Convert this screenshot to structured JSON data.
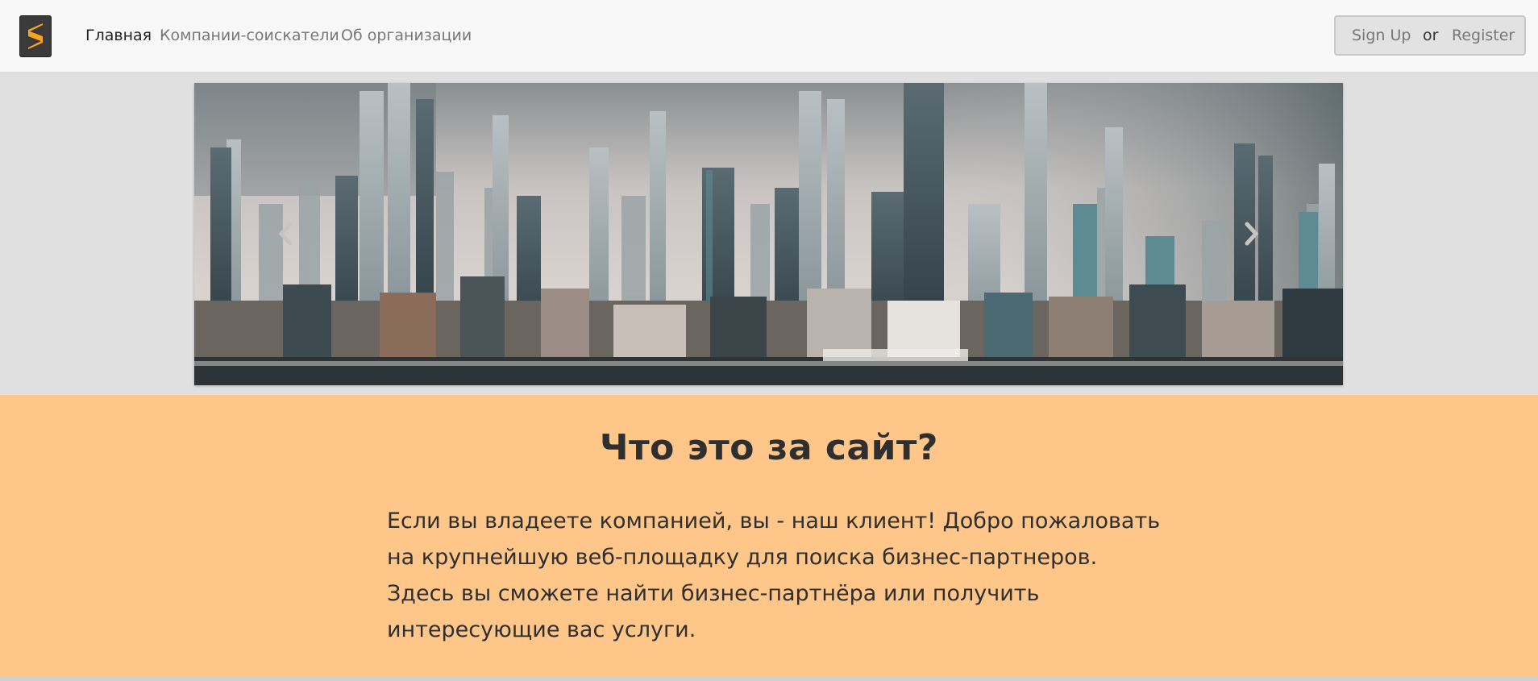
{
  "navbar": {
    "logo_icon": "sublime-s-logo-icon",
    "links": [
      {
        "label": "Главная",
        "active": true
      },
      {
        "label": "Компании-соискатели",
        "active": false
      },
      {
        "label": "Об организации",
        "active": false
      }
    ],
    "auth": {
      "signup": "Sign Up",
      "or": "or",
      "register": "Register"
    }
  },
  "carousel": {
    "image": "city-skyline-photo",
    "prev_icon": "chevron-left-icon",
    "next_icon": "chevron-right-icon"
  },
  "about": {
    "title": "Что это за сайт?",
    "text": "Если вы владеете компанией, вы - наш клиент! Добро пожаловать на крупнейшую веб-площадку для поиска бизнес-партнеров. Здесь вы сможете найти бизнес-партнёра или получить интересующие вас услуги."
  },
  "colors": {
    "accent_section": "#fec688",
    "logo_orange": "#f7a622",
    "navbar_bg": "#f8f8f8",
    "page_bg": "#e0e0e0"
  }
}
